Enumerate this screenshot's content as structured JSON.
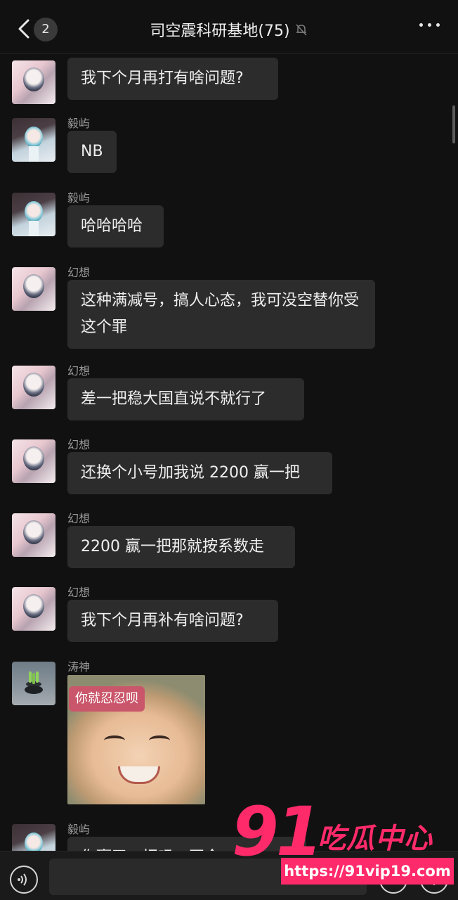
{
  "header": {
    "back_count": "2",
    "title": "司空震科研基地(75)"
  },
  "messages": [
    {
      "sender": "",
      "text": "我下个月再打有啥问题?"
    },
    {
      "sender": "毅屿",
      "text": "NB"
    },
    {
      "sender": "毅屿",
      "text": "哈哈哈哈"
    },
    {
      "sender": "幻想",
      "text": "这种满减号，搞人心态，我可没空替你受这个罪"
    },
    {
      "sender": "幻想",
      "text": "差一把稳大国直说不就行了"
    },
    {
      "sender": "幻想",
      "text": "还换个小号加我说 2200 赢一把"
    },
    {
      "sender": "幻想",
      "text": "2200 赢一把那就按系数走"
    },
    {
      "sender": "幻想",
      "text": "我下个月再补有啥问题?"
    },
    {
      "sender": "涛神",
      "sticker_text": "你就忍忍呗"
    },
    {
      "sender": "毅屿",
      "text": "你赢了一把吗，至今..."
    }
  ],
  "watermark": {
    "number": "91",
    "brand": "吃瓜中心",
    "url": "https://91vip19.com"
  },
  "colors": {
    "background": "#111111",
    "bubble": "#2c2c2c",
    "watermark": "#ff2a6a"
  }
}
